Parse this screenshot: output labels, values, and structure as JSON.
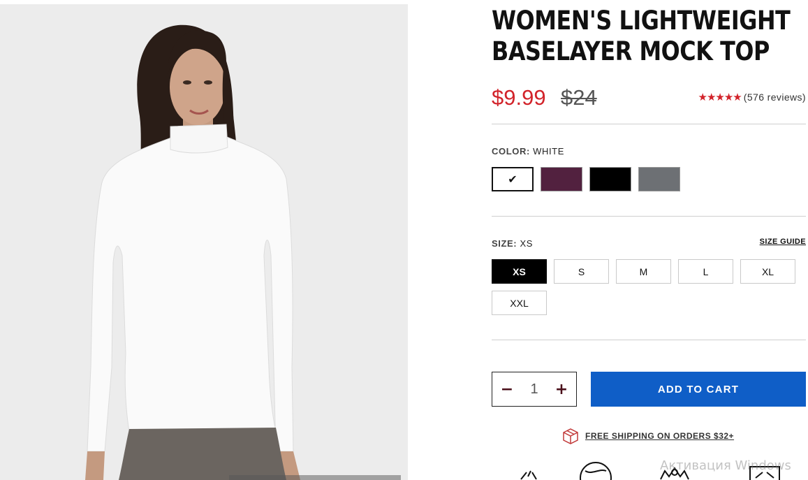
{
  "product": {
    "title_line1": "WOMEN'S LIGHTWEIGHT",
    "title_line2": "BASELAYER MOCK TOP",
    "price_sale": "$9.99",
    "price_original": "$24",
    "rating_stars": "★★★★★",
    "reviews": "(576 reviews)"
  },
  "color": {
    "label": "COLOR:",
    "selected": "WHITE",
    "swatches": [
      {
        "name": "white",
        "hex": "#ffffff",
        "selected": true
      },
      {
        "name": "plum",
        "hex": "#52213f",
        "selected": false
      },
      {
        "name": "black",
        "hex": "#000000",
        "selected": false
      },
      {
        "name": "gray",
        "hex": "#6d7074",
        "selected": false
      }
    ]
  },
  "size": {
    "label": "SIZE:",
    "selected": "XS",
    "guide": "SIZE GUIDE",
    "options": [
      "XS",
      "S",
      "M",
      "L",
      "XL",
      "XXL"
    ]
  },
  "quantity": {
    "minus": "−",
    "value": "1",
    "plus": "+"
  },
  "cart": {
    "add_label": "ADD TO CART"
  },
  "shipping": {
    "text": "FREE SHIPPING ON ORDERS $32+"
  },
  "os_overlay": {
    "activation_text": "Активация Windows"
  },
  "colors": {
    "accent_red": "#d2232a",
    "cart_blue": "#0f5ec7"
  }
}
